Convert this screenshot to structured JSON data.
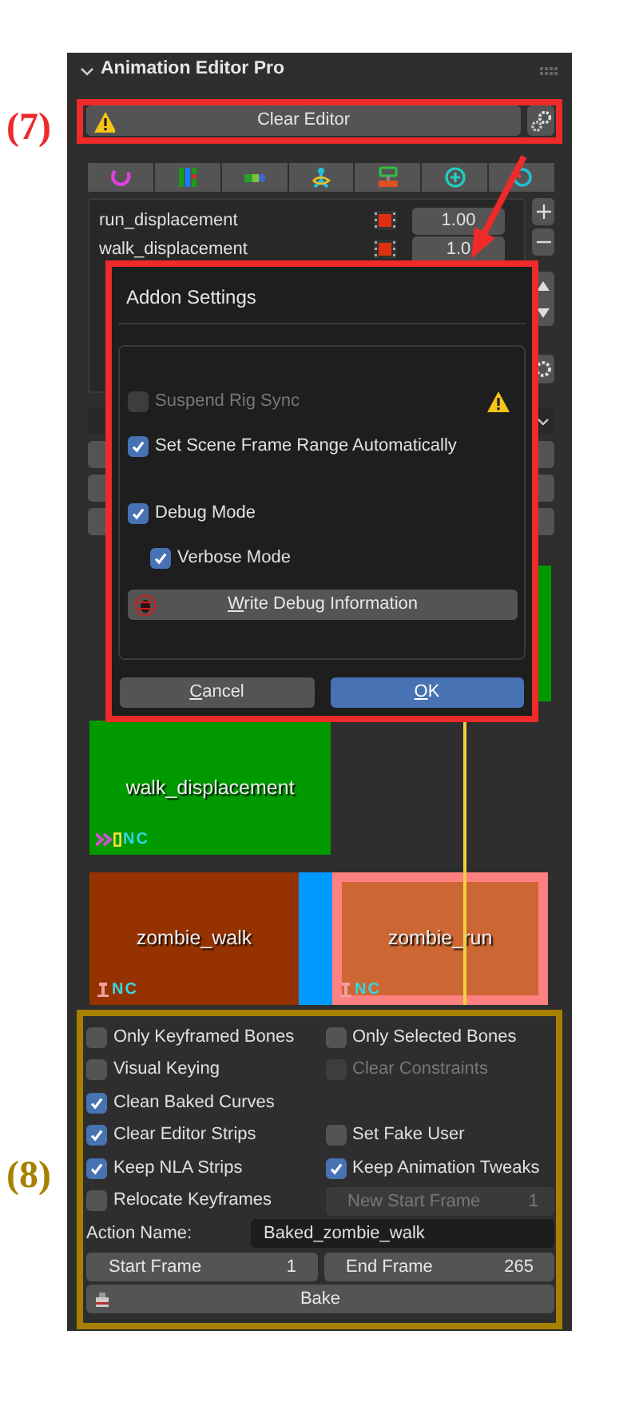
{
  "panel": {
    "title": "Animation Editor Pro",
    "expanded": true
  },
  "annotations": [
    {
      "label": "(7)",
      "color": "#ee2a2a"
    },
    {
      "label": "(8)",
      "color": "#a88000"
    }
  ],
  "clear_button": {
    "label": "Clear Editor"
  },
  "tracks": [
    {
      "name": "run_displacement",
      "value": "1.00"
    },
    {
      "name": "walk_displacement",
      "value": "1.0"
    }
  ],
  "dialog": {
    "title": "Addon Settings",
    "options": [
      {
        "label": "Suspend Rig Sync",
        "checked": false,
        "disabled": true,
        "warning": true
      },
      {
        "label": "Set Scene Frame Range Automatically",
        "checked": true,
        "disabled": false,
        "warning": false
      },
      {
        "label": "Debug Mode",
        "checked": true,
        "disabled": false,
        "warning": false
      },
      {
        "label": "Verbose Mode",
        "checked": true,
        "disabled": false,
        "warning": false
      }
    ],
    "debug_button": {
      "label": "Write Debug Information",
      "first_letter_underlined": true
    },
    "buttons": [
      {
        "label": "Cancel",
        "primary": false,
        "first_letter_underlined": true
      },
      {
        "label": "OK",
        "primary": true,
        "first_letter_underlined": true
      }
    ]
  },
  "strips": [
    {
      "color": "#009900",
      "selected": false
    },
    {
      "name": "walk_displacement",
      "color": "#009900",
      "selected": false,
      "kind": "meta",
      "tag": "NC"
    },
    {
      "name": "zombie_walk",
      "color": "#963200",
      "selected": false,
      "kind": "action",
      "tag": "NC"
    },
    {
      "color": "#0099ff",
      "selected": false
    },
    {
      "name": "zombie_run",
      "color": "#cc6633",
      "selected": true,
      "kind": "action",
      "tag": "NC"
    }
  ],
  "bake": {
    "rows": [
      [
        {
          "kind": "checkbox",
          "label": "Only Keyframed Bones",
          "checked": false,
          "disabled": false
        },
        {
          "kind": "checkbox",
          "label": "Only Selected Bones",
          "checked": false,
          "disabled": false
        }
      ],
      [
        {
          "kind": "checkbox",
          "label": "Visual Keying",
          "checked": false,
          "disabled": false
        },
        {
          "kind": "checkbox",
          "label": "Clear Constraints",
          "checked": false,
          "disabled": true
        }
      ],
      [
        {
          "kind": "checkbox",
          "label": "Clean Baked Curves",
          "checked": true,
          "disabled": false
        }
      ],
      [
        {
          "kind": "checkbox",
          "label": "Clear Editor Strips",
          "checked": true,
          "disabled": false
        },
        {
          "kind": "checkbox",
          "label": "Set Fake User",
          "checked": false,
          "disabled": false
        }
      ],
      [
        {
          "kind": "checkbox",
          "label": "Keep NLA Strips",
          "checked": true,
          "disabled": false
        },
        {
          "kind": "checkbox",
          "label": "Keep Animation Tweaks",
          "checked": true,
          "disabled": false
        }
      ],
      [
        {
          "kind": "checkbox",
          "label": "Relocate Keyframes",
          "checked": false,
          "disabled": false
        },
        {
          "kind": "number",
          "label": "New Start Frame",
          "value": "1",
          "disabled": true
        }
      ]
    ],
    "action_name": {
      "label": "Action Name:",
      "value": "Baked_zombie_walk"
    },
    "frames": [
      {
        "label": "Start Frame",
        "value": "1"
      },
      {
        "label": "End Frame",
        "value": "265"
      }
    ],
    "bake_button": {
      "label": "Bake"
    }
  }
}
